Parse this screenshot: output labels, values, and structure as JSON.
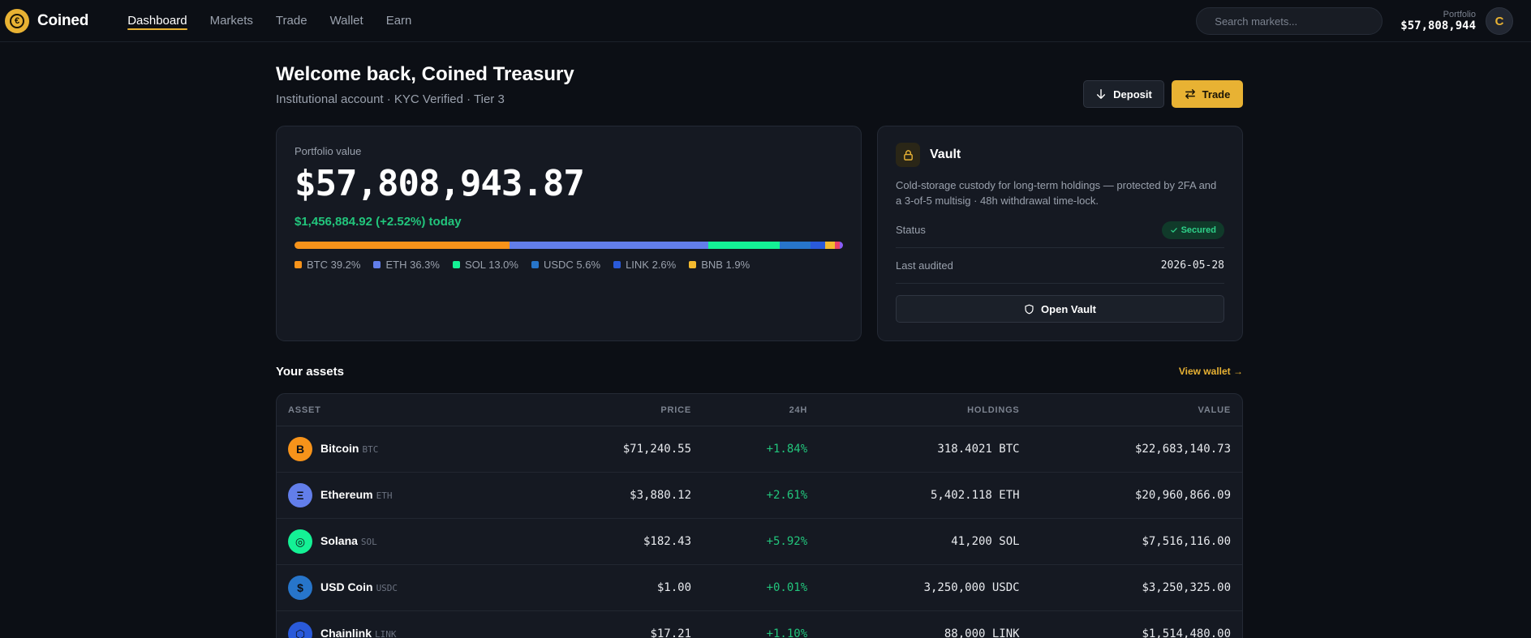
{
  "brand": {
    "name": "Coined",
    "logo_glyph": "€"
  },
  "nav": {
    "items": [
      {
        "label": "Dashboard",
        "active": true
      },
      {
        "label": "Markets",
        "active": false
      },
      {
        "label": "Trade",
        "active": false
      },
      {
        "label": "Wallet",
        "active": false
      },
      {
        "label": "Earn",
        "active": false
      }
    ],
    "search_placeholder": "Search markets...",
    "portfolio_label": "Portfolio",
    "portfolio_value": "$57,808,944",
    "avatar_initial": "C"
  },
  "header": {
    "title": "Welcome back, Coined Treasury",
    "subtitle": "Institutional account · KYC Verified · Tier 3",
    "deposit_label": "Deposit",
    "trade_label": "Trade"
  },
  "portfolio": {
    "label": "Portfolio value",
    "value": "$57,808,943.87",
    "change": "$1,456,884.92 (+2.52%) today",
    "allocation": [
      {
        "symbol": "BTC",
        "pct": 39.2,
        "label": "BTC 39.2%",
        "color": "#f7931a"
      },
      {
        "symbol": "ETH",
        "pct": 36.3,
        "label": "ETH 36.3%",
        "color": "#627eea"
      },
      {
        "symbol": "SOL",
        "pct": 13.0,
        "label": "SOL 13.0%",
        "color": "#14f195"
      },
      {
        "symbol": "USDC",
        "pct": 5.6,
        "label": "USDC 5.6%",
        "color": "#2775ca"
      },
      {
        "symbol": "LINK",
        "pct": 2.6,
        "label": "LINK 2.6%",
        "color": "#2a5ada"
      },
      {
        "symbol": "BNB",
        "pct": 1.9,
        "label": "BNB 1.9%",
        "color": "#f3ba2f"
      },
      {
        "symbol": "OTHER1",
        "pct": 0.8,
        "label": "",
        "color": "#e8406b"
      },
      {
        "symbol": "OTHER2",
        "pct": 0.6,
        "label": "",
        "color": "#8b5cf6"
      }
    ]
  },
  "vault": {
    "title": "Vault",
    "description": "Cold-storage custody for long-term holdings — protected by 2FA and a 3-of-5 multisig · 48h withdrawal time-lock.",
    "status_label": "Status",
    "status_value": "Secured",
    "audit_label": "Last audited",
    "audit_value": "2026-05-28",
    "open_label": "Open Vault"
  },
  "assets": {
    "title": "Your assets",
    "view_wallet": "View wallet →",
    "columns": [
      "ASSET",
      "PRICE",
      "24H",
      "HOLDINGS",
      "VALUE"
    ],
    "rows": [
      {
        "name": "Bitcoin",
        "symbol": "BTC",
        "glyph": "B",
        "color": "#f7931a",
        "price": "$71,240.55",
        "change": "+1.84%",
        "holdings": "318.4021 BTC",
        "value": "$22,683,140.73"
      },
      {
        "name": "Ethereum",
        "symbol": "ETH",
        "glyph": "Ξ",
        "color": "#627eea",
        "price": "$3,880.12",
        "change": "+2.61%",
        "holdings": "5,402.118 ETH",
        "value": "$20,960,866.09"
      },
      {
        "name": "Solana",
        "symbol": "SOL",
        "glyph": "◎",
        "color": "#14f195",
        "price": "$182.43",
        "change": "+5.92%",
        "holdings": "41,200 SOL",
        "value": "$7,516,116.00"
      },
      {
        "name": "USD Coin",
        "symbol": "USDC",
        "glyph": "$",
        "color": "#2775ca",
        "price": "$1.00",
        "change": "+0.01%",
        "holdings": "3,250,000 USDC",
        "value": "$3,250,325.00"
      },
      {
        "name": "Chainlink",
        "symbol": "LINK",
        "glyph": "⬡",
        "color": "#2a5ada",
        "price": "$17.21",
        "change": "+1.10%",
        "holdings": "88,000 LINK",
        "value": "$1,514,480.00"
      }
    ]
  }
}
